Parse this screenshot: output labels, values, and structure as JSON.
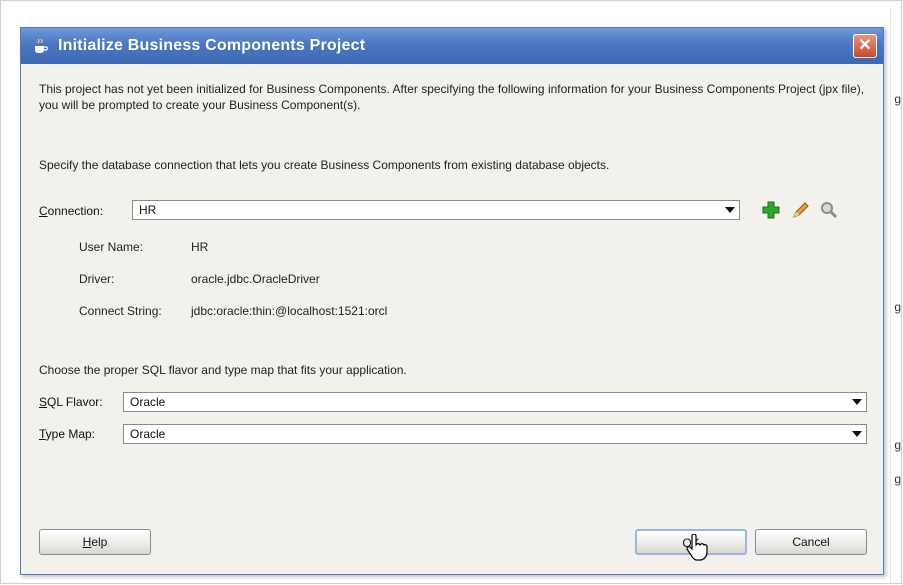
{
  "background": {
    "edge_glyphs": [
      "g",
      "g",
      "g",
      "g"
    ]
  },
  "dialog": {
    "title": "Initialize Business Components Project",
    "close_glyph": "✕",
    "intro_text": "This project has not yet been initialized for Business Components.  After specifying the following information for your Business Components Project (jpx file), you will be prompted to create your Business Component(s).",
    "connection_instruction": "Specify the database connection that lets you create Business Components from existing database objects.",
    "connection": {
      "label_mnemonic": "C",
      "label_rest": "onnection:",
      "value": "HR"
    },
    "connection_info": {
      "user_name_label": "User Name:",
      "user_name_value": "HR",
      "driver_label": "Driver:",
      "driver_value": "oracle.jdbc.OracleDriver",
      "connect_string_label": "Connect String:",
      "connect_string_value": "jdbc:oracle:thin:@localhost:1521:orcl"
    },
    "flavor_instruction": "Choose the proper SQL flavor and type map that fits your application.",
    "sql_flavor": {
      "label_mnemonic": "S",
      "label_rest": "QL Flavor:",
      "value": "Oracle"
    },
    "type_map": {
      "label_mnemonic": "T",
      "label_rest": "ype Map:",
      "value": "Oracle"
    },
    "buttons": {
      "help_mnemonic": "H",
      "help_rest": "elp",
      "ok_label": "OK",
      "cancel_label": "Cancel"
    }
  },
  "icons": {
    "title": "coffee-cup-icon",
    "add": "green-plus-icon",
    "edit": "pencil-icon",
    "browse": "magnifier-icon"
  },
  "colors": {
    "titlebar": "#4b77c2",
    "dialog_bg": "#f2f1ec",
    "close_button": "#c9482a"
  }
}
